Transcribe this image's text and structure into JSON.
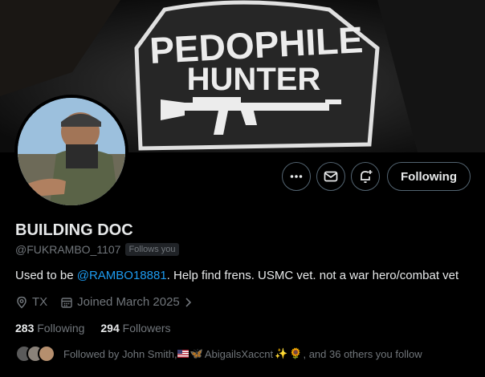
{
  "banner": {
    "patch_line1": "PEDOPHILE",
    "patch_line2": "HUNTER"
  },
  "actions": {
    "more_icon": "ellipsis-icon",
    "message_icon": "envelope-icon",
    "notify_icon": "bell-plus-icon",
    "follow_label": "Following"
  },
  "profile": {
    "display_name": "BUILDING DOC",
    "handle": "@FUKRAMBO_1107",
    "follows_you": "Follows you",
    "bio_prefix": "Used to be ",
    "bio_mention": "@RAMBO18881",
    "bio_suffix": ".  Help find frens. USMC vet. not a war hero/combat vet",
    "location": "TX",
    "joined": "Joined March 2025"
  },
  "stats": {
    "following_count": "283",
    "following_label": "Following",
    "followers_count": "294",
    "followers_label": "Followers"
  },
  "followed_by": {
    "prefix": "Followed by John Smith, ",
    "name2": "AbigailsXaccnt",
    "suffix": ", and 36 others you follow"
  },
  "colors": {
    "accent": "#1d9bf0",
    "muted": "#71767b",
    "border": "#536471"
  }
}
